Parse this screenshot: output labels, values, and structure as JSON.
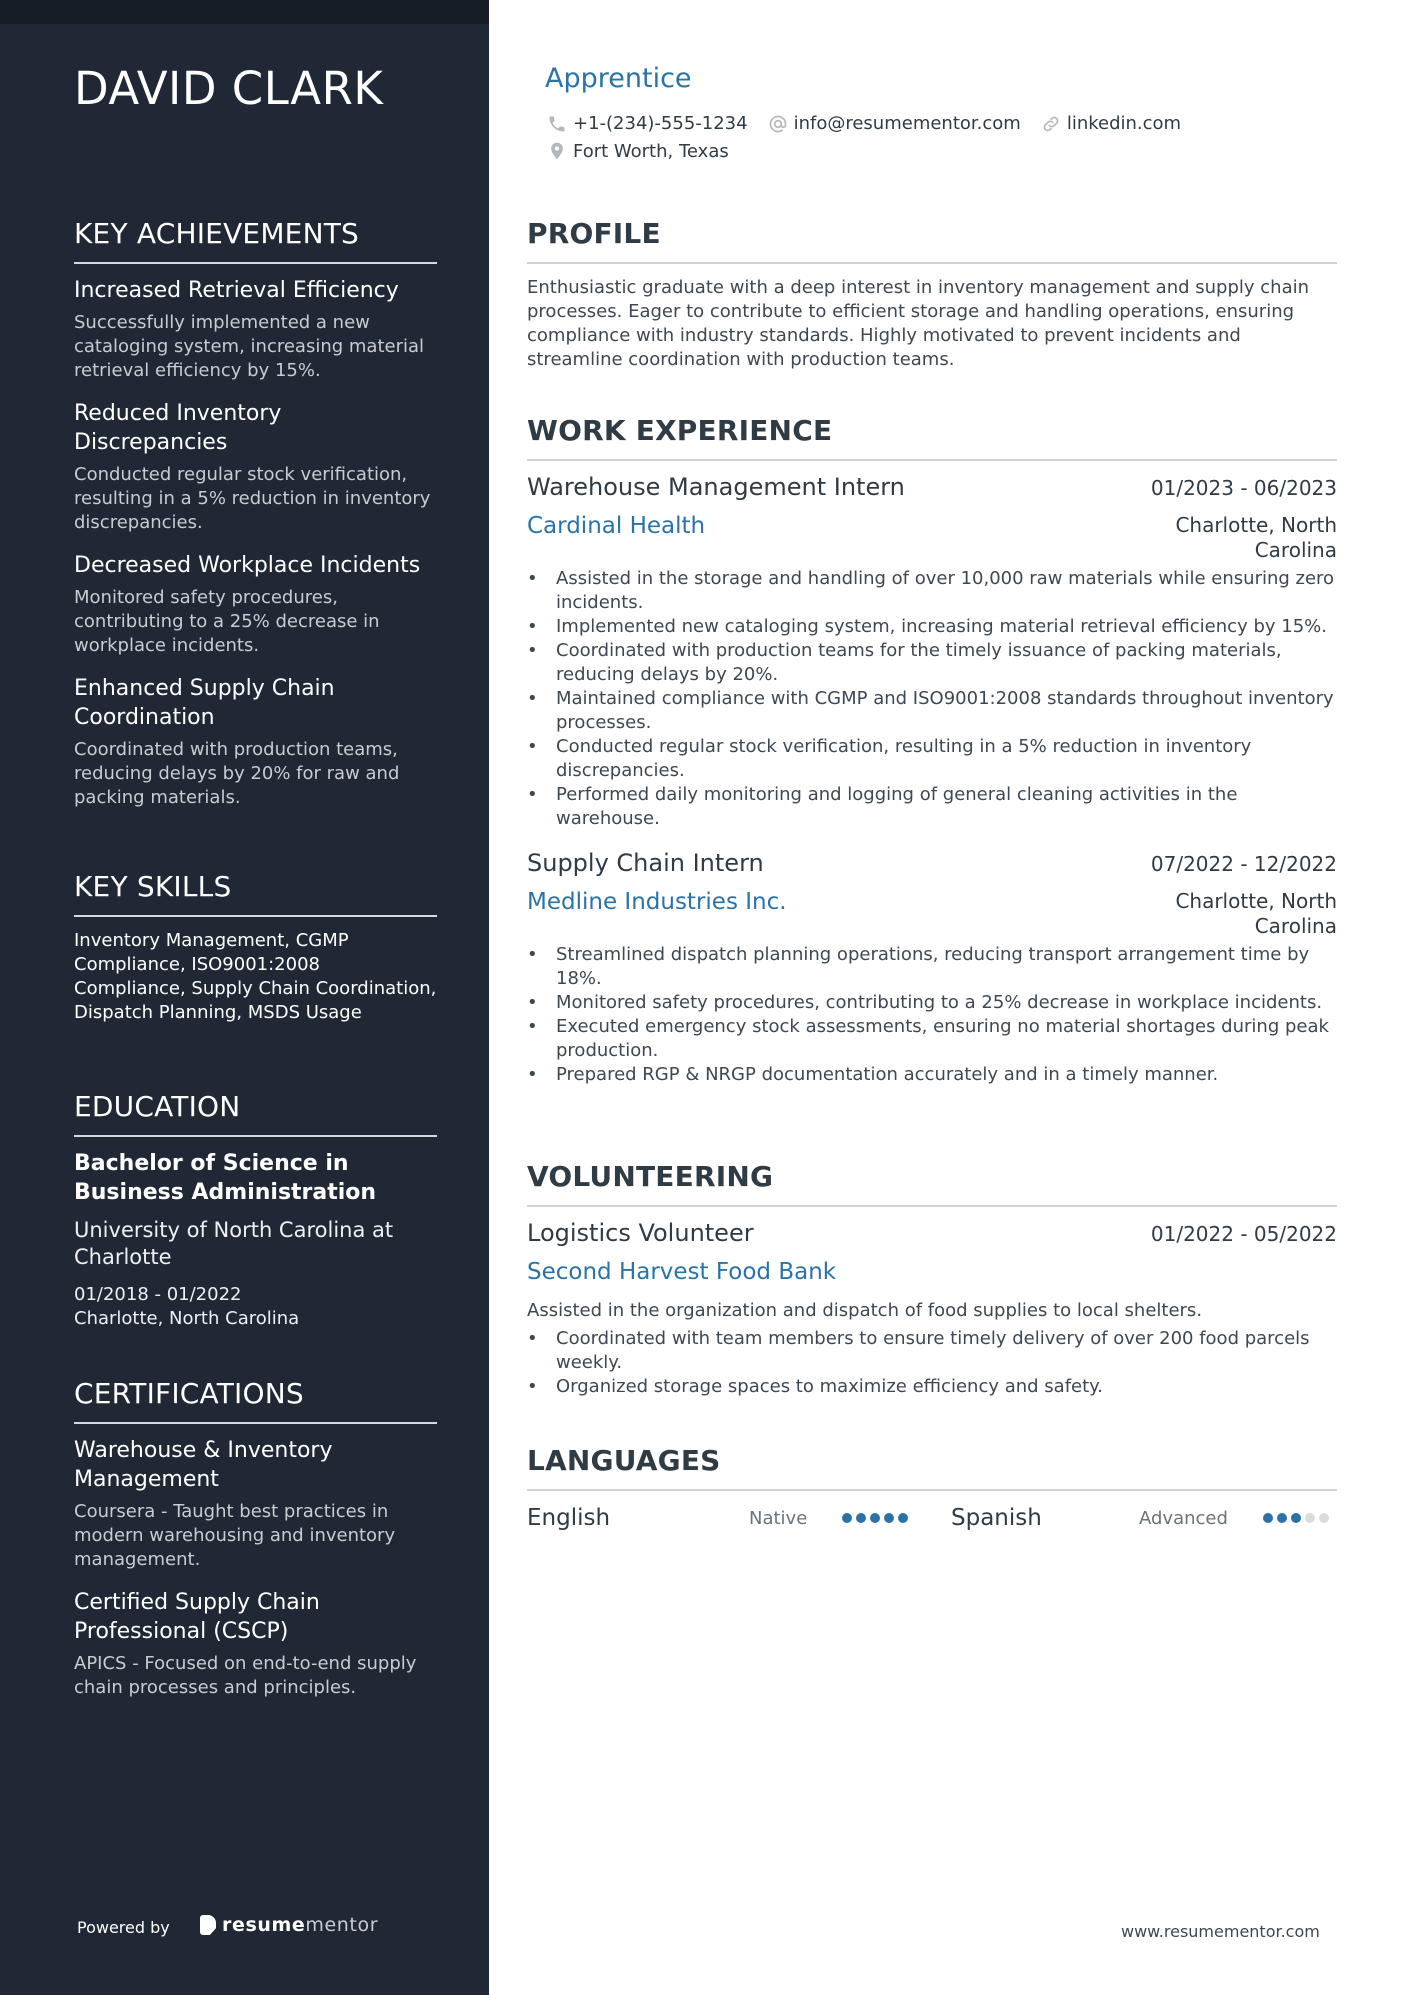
{
  "colors": {
    "sidebar_bg": "#1f2834",
    "accent": "#2b73a6",
    "text": "#2f3b45"
  },
  "sidebar": {
    "name": "DAVID CLARK",
    "achievements": {
      "title": "KEY ACHIEVEMENTS",
      "items": [
        {
          "title": "Increased Retrieval Efficiency",
          "desc": "Successfully implemented a new cataloging system, increasing material retrieval efficiency by 15%."
        },
        {
          "title": "Reduced Inventory Discrepancies",
          "desc": "Conducted regular stock verification, resulting in a 5% reduction in inventory discrepancies."
        },
        {
          "title": "Decreased Workplace Incidents",
          "desc": "Monitored safety procedures, contributing to a 25% decrease in workplace incidents."
        },
        {
          "title": "Enhanced Supply Chain Coordination",
          "desc": "Coordinated with production teams, reducing delays by 20% for raw and packing materials."
        }
      ]
    },
    "skills": {
      "title": "KEY SKILLS",
      "text": "Inventory Management, CGMP Compliance, ISO9001:2008 Compliance, Supply Chain Coordination, Dispatch Planning, MSDS Usage"
    },
    "education": {
      "title": "EDUCATION",
      "degree": "Bachelor of Science in Business Administration",
      "school": "University of North Carolina at Charlotte",
      "dates": "01/2018 - 01/2022",
      "location": "Charlotte, North Carolina"
    },
    "certifications": {
      "title": "CERTIFICATIONS",
      "items": [
        {
          "title": "Warehouse & Inventory Management",
          "desc": "Coursera - Taught best practices in modern warehousing and inventory management."
        },
        {
          "title": "Certified Supply Chain Professional (CSCP)",
          "desc": "APICS - Focused on end-to-end supply chain processes and principles."
        }
      ]
    },
    "footer": {
      "powered_by": "Powered by",
      "brand_bold": "resume",
      "brand_light": "mentor"
    }
  },
  "header": {
    "job_title": "Apprentice",
    "phone": "+1-(234)-555-1234",
    "email": "info@resumementor.com",
    "link": "linkedin.com",
    "location": "Fort Worth, Texas",
    "icons": [
      "phone-icon",
      "at-icon",
      "link-icon",
      "location-pin-icon"
    ]
  },
  "profile": {
    "title": "PROFILE",
    "text": "Enthusiastic graduate with a deep interest in inventory management and supply chain processes. Eager to contribute to efficient storage and handling operations, ensuring compliance with industry standards. Highly motivated to prevent incidents and streamline coordination with production teams."
  },
  "experience": {
    "title": "WORK EXPERIENCE",
    "jobs": [
      {
        "role": "Warehouse Management Intern",
        "dates": "01/2023 - 06/2023",
        "company": "Cardinal Health",
        "location": "Charlotte, North Carolina",
        "bullets": [
          "Assisted in the storage and handling of over 10,000 raw materials while ensuring zero incidents.",
          "Implemented new cataloging system, increasing material retrieval efficiency by 15%.",
          "Coordinated with production teams for the timely issuance of packing materials, reducing delays by 20%.",
          "Maintained compliance with CGMP and ISO9001:2008 standards throughout inventory processes.",
          "Conducted regular stock verification, resulting in a 5% reduction in inventory discrepancies.",
          "Performed daily monitoring and logging of general cleaning activities in the warehouse."
        ]
      },
      {
        "role": "Supply Chain Intern",
        "dates": "07/2022 - 12/2022",
        "company": "Medline Industries Inc.",
        "location": "Charlotte, North Carolina",
        "bullets": [
          "Streamlined dispatch planning operations, reducing transport arrangement time by 18%.",
          "Monitored safety procedures, contributing to a 25% decrease in workplace incidents.",
          "Executed emergency stock assessments, ensuring no material shortages during peak production.",
          "Prepared RGP & NRGP documentation accurately and in a timely manner."
        ]
      }
    ]
  },
  "volunteering": {
    "title": "VOLUNTEERING",
    "role": "Logistics Volunteer",
    "dates": "01/2022 - 05/2022",
    "org": "Second Harvest Food Bank",
    "desc": "Assisted in the organization and dispatch of food supplies to local shelters.",
    "bullets": [
      "Coordinated with team members to ensure timely delivery of over 200 food parcels weekly.",
      "Organized storage spaces to maximize efficiency and safety."
    ]
  },
  "languages": {
    "title": "LANGUAGES",
    "items": [
      {
        "name": "English",
        "level": "Native",
        "rating": 5,
        "max": 5
      },
      {
        "name": "Spanish",
        "level": "Advanced",
        "rating": 3,
        "max": 5
      }
    ]
  },
  "footer": {
    "site": "www.resumementor.com"
  }
}
